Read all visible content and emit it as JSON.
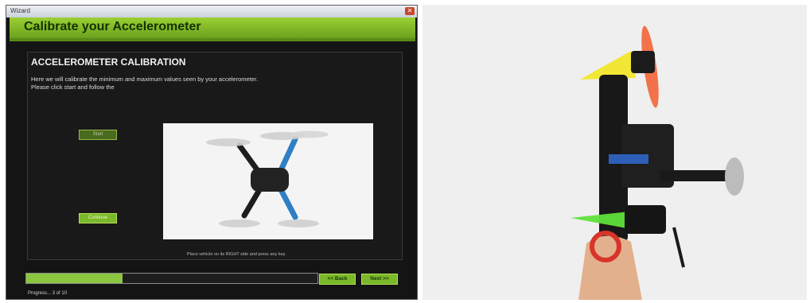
{
  "window": {
    "title": "Wizard",
    "close_glyph": "✕"
  },
  "header": {
    "title": "Calibrate your Accelerometer"
  },
  "panel": {
    "section_title": "ACCELEROMETER CALIBRATION",
    "instructions": "Here we will calibrate the minimum and maximum values seen by your accelerometer. Please click start and follow the",
    "start_label": "Start",
    "continue_label": "Continue",
    "caption": "Place vehicle on its RIGHT side and press any key."
  },
  "footer": {
    "progress_fraction": 0.33,
    "back_label": "<< Back",
    "next_label": "Next >>",
    "status": "Progress... 3 of 10"
  },
  "colors": {
    "accent": "#8cc63f",
    "header_dark": "#5b8a17",
    "window_bg": "#141414"
  }
}
